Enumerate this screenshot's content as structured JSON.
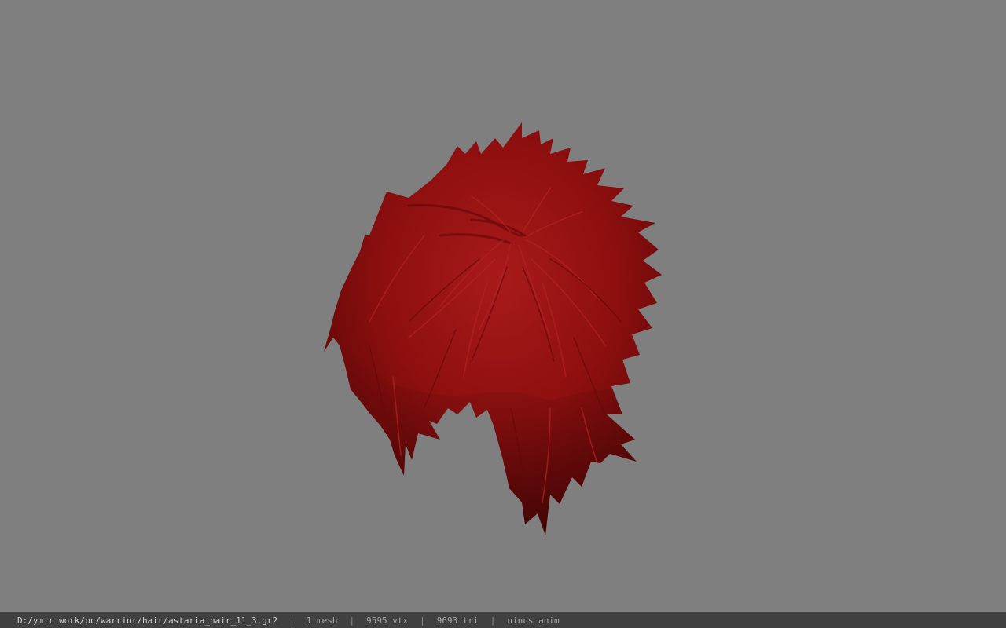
{
  "viewport": {
    "background_color": "#7f7f7f",
    "model": {
      "type": "hair mesh",
      "color": "#8e0f0f",
      "highlight_color": "#b52222",
      "shadow_color": "#5a0606"
    }
  },
  "statusbar": {
    "file_path": "D:/ymir work/pc/warrior/hair/astaria_hair_11_3.gr2",
    "mesh_count": "1 mesh",
    "vertex_count": "9595 vtx",
    "triangle_count": "9693 tri",
    "anim_status": "nincs anim",
    "separator": "|"
  }
}
